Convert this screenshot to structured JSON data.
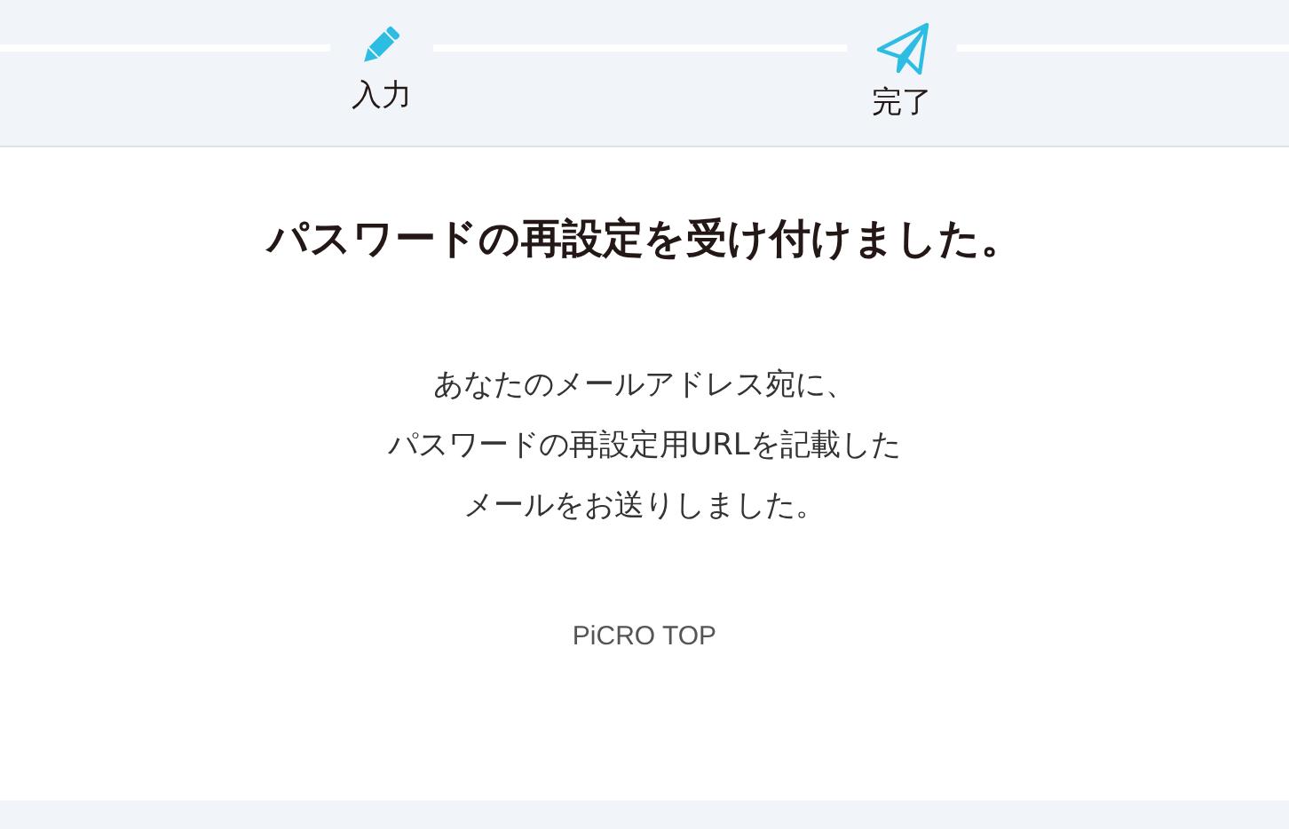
{
  "steps": [
    {
      "kind": "edit",
      "label": "入力"
    },
    {
      "kind": "send",
      "label": "完了"
    }
  ],
  "heading": "パスワードの再設定を受け付けました。",
  "message": [
    "あなたのメールアドレス宛に、",
    "パスワードの再設定用URLを記載した",
    "メールをお送りしました。"
  ],
  "link": "PiCRO TOP"
}
